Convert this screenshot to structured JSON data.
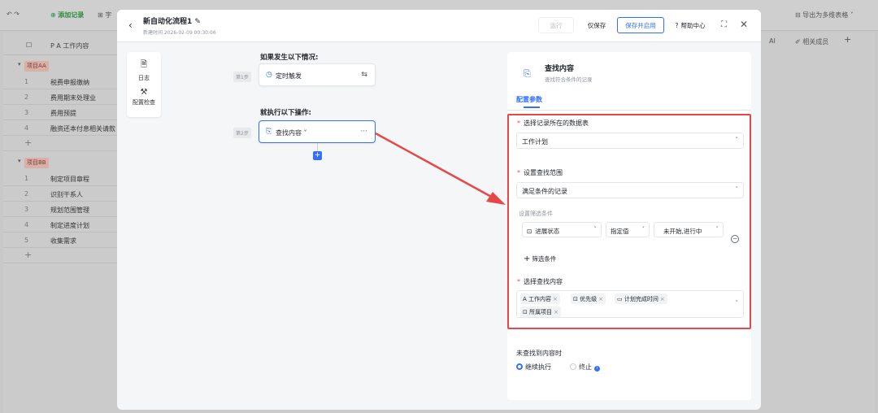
{
  "background": {
    "toolbar": {
      "add_record": "添加记录",
      "field": "字",
      "export": "导出为多维表格"
    },
    "header": {
      "work_content": "工作内容",
      "ai": "AI",
      "related_member": "相关成员"
    },
    "groups": [
      {
        "tag": "项目AA",
        "rows": [
          {
            "n": "1",
            "t": "税费申报缴纳"
          },
          {
            "n": "2",
            "t": "费用期末处理业"
          },
          {
            "n": "3",
            "t": "费用预提"
          },
          {
            "n": "4",
            "t": "融资还本付息相关请款"
          }
        ]
      },
      {
        "tag": "项目BB",
        "rows": [
          {
            "n": "1",
            "t": "制定项目章程"
          },
          {
            "n": "2",
            "t": "识别干系人"
          },
          {
            "n": "3",
            "t": "规划范围管理"
          },
          {
            "n": "4",
            "t": "制定进度计划"
          },
          {
            "n": "5",
            "t": "收集需求"
          }
        ]
      }
    ]
  },
  "modal": {
    "title": "新自动化流程1",
    "subtitle": "新建时间 2026-02-09 00:30:06",
    "buttons": {
      "run": "运行",
      "save": "仅保存",
      "save_enable": "保存并启用",
      "help": "帮助中心"
    },
    "sidebar": [
      {
        "label": "日志",
        "icon": "log-icon"
      },
      {
        "label": "配置检查",
        "icon": "wrench-icon"
      }
    ],
    "canvas": {
      "trigger_heading": "如果发生以下情况:",
      "action_heading": "就执行以下操作:",
      "step1_tag": "第1步",
      "step1_label": "定时触发",
      "step2_tag": "第2步",
      "step2_label": "查找内容"
    },
    "panel": {
      "title": "查找内容",
      "subtitle": "查找符合条件的记录",
      "tab": "配置参数",
      "table_label": "选择记录所在的数据表",
      "table_value": "工作计划",
      "range_label": "设置查找范围",
      "range_value": "满足条件的记录",
      "filter_label": "设置筛选条件",
      "cond_field": "进展状态",
      "cond_op": "指定值",
      "cond_value": "未开始,进行中",
      "add_condition": "筛选条件",
      "content_label": "选择查找内容",
      "content_tags": [
        "工作内容",
        "优先级",
        "计划完成时间",
        "所属项目"
      ],
      "not_found_label": "未查找到内容时",
      "opt_continue": "继续执行",
      "opt_stop": "终止"
    }
  }
}
